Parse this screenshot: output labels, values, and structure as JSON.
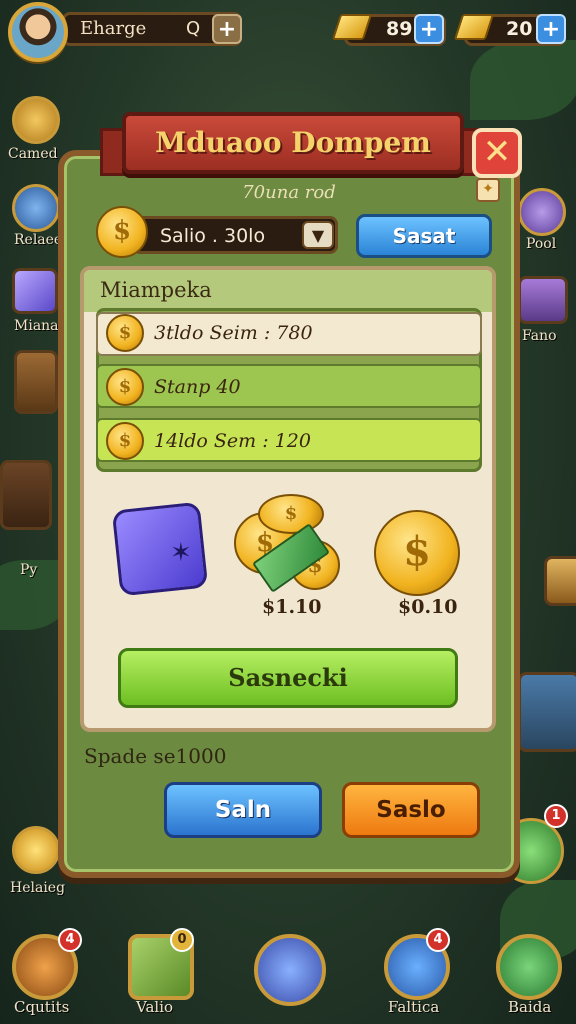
{
  "player": {
    "name": "Eharge",
    "level": "Q"
  },
  "resources": [
    {
      "icon": "gold-bar-icon",
      "value": "89"
    },
    {
      "icon": "gold-bar-icon",
      "value": "20"
    }
  ],
  "side_left": [
    {
      "icon": "camel-icon",
      "label": "Camed"
    },
    {
      "icon": "shield-check-icon",
      "label": "Relaee"
    },
    {
      "icon": "dice-icon",
      "label": "Miana"
    },
    {
      "icon": "chest-icon",
      "label": "Py"
    },
    {
      "icon": "dollar-coin-icon",
      "label": "Helaieg"
    }
  ],
  "side_right": [
    {
      "icon": "hammer-icon",
      "label": "Pool"
    },
    {
      "icon": "treasure-chest-icon",
      "label": "Fano"
    },
    {
      "icon": "green-token-icon",
      "badge": "1"
    }
  ],
  "dialog": {
    "title": "Mduaoo Dompem",
    "close": "✕",
    "subtitle": "70una rod",
    "select_value": "Salio . 30lo",
    "select_button": "Sasat",
    "section_title": "Miampeka",
    "rows": [
      "3tldo Seim : 780",
      "Stanp 40",
      "14ldo Sem : 120"
    ],
    "prices": [
      "$1.10",
      "$0.10"
    ],
    "main_button": "Sasnecki",
    "info_text": "Spade se1000",
    "left_button": "Saln",
    "right_button": "Saslo"
  },
  "bottom_nav": [
    {
      "icon": "crate-icon",
      "label": "Cqutits",
      "badge": "4"
    },
    {
      "icon": "map-scroll-icon",
      "label": "Valio",
      "badge": "0"
    },
    {
      "icon": "sword-icon",
      "label": ""
    },
    {
      "icon": "blue-box-icon",
      "label": "Faltica",
      "badge": "4"
    },
    {
      "icon": "magnifier-icon",
      "label": "Baida"
    }
  ],
  "colors": {
    "panel": "#6d8a41",
    "banner": "#c94a3a",
    "accent_blue": "#2b84d6",
    "accent_green": "#6dbf22",
    "accent_orange": "#ee7a10"
  }
}
